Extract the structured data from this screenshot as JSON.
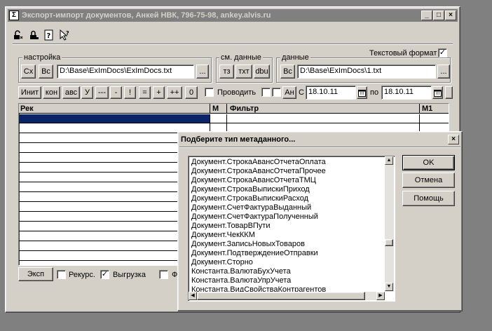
{
  "main_window": {
    "title": "Экспорт-импорт документов, Анкей НВК, 796-75-98, ankey.alvis.ru",
    "minimize_glyph": "_",
    "maximize_glyph": "□",
    "close_glyph": "×",
    "toolbar_icons": [
      "lock-open-icon",
      "lock-closed-icon",
      "help-icon",
      "whats-this-icon"
    ],
    "text_format_label": "Текстовый формат",
    "text_format_checked": true,
    "settings_group": {
      "title": "настройка",
      "btn_cx": "Сх",
      "btn_vs": "Вс",
      "path": "D:\\Base\\ExImDocs\\ExImDocs.txt",
      "browse": "..."
    },
    "view_data_group": {
      "title": "см. данные",
      "btn_tz": "тз",
      "btn_txt": "тхт",
      "btn_dbu": "dbu"
    },
    "data_group": {
      "title": "данные",
      "btn_vs": "Вс",
      "path": "D:\\Base\\ExImDocs\\1.txt",
      "browse": "..."
    },
    "action_row": {
      "buttons": [
        "Инит",
        "кон",
        "авс",
        "У",
        "---",
        "-",
        "!",
        "=",
        "+",
        "++",
        "0"
      ],
      "post_label": "Проводить",
      "an_button": "Ан",
      "from_label": "С",
      "date_from": "18.10.11",
      "to_label": "по",
      "date_to": "18.10.11"
    },
    "grid": {
      "columns": [
        "Рек",
        "М",
        "Фильтр",
        "М1"
      ]
    },
    "bottom": {
      "export_button": "Эксп",
      "recursive_label": "Рекурс.",
      "recursive_checked": false,
      "unload_label": "Выгрузка",
      "unload_checked": true,
      "partial_label": "Ф"
    }
  },
  "dialog": {
    "title": "Подберите тип метаданного...",
    "close_glyph": "×",
    "items": [
      "Документ.СтрокаАвансОтчетаОплата",
      "Документ.СтрокаАвансОтчетаПрочее",
      "Документ.СтрокаАвансОтчетаТМЦ",
      "Документ.СтрокаВыпискиПриход",
      "Документ.СтрокаВыпискиРасход",
      "Документ.СчетФактураВыданный",
      "Документ.СчетФактураПолученный",
      "Документ.ТоварВПути",
      "Документ.ЧекККМ",
      "Документ.ЗаписьНовыхТоваров",
      "Документ.ПодтверждениеОтправки",
      "Документ.Сторно",
      "Константа.ВалютаБухУчета",
      "Константа.ВалютаУпрУчета",
      "Константа.ВидСвойстваКонтрагентов"
    ],
    "ok_button": "OK",
    "cancel_button": "Отмена",
    "help_button": "Помощь"
  }
}
